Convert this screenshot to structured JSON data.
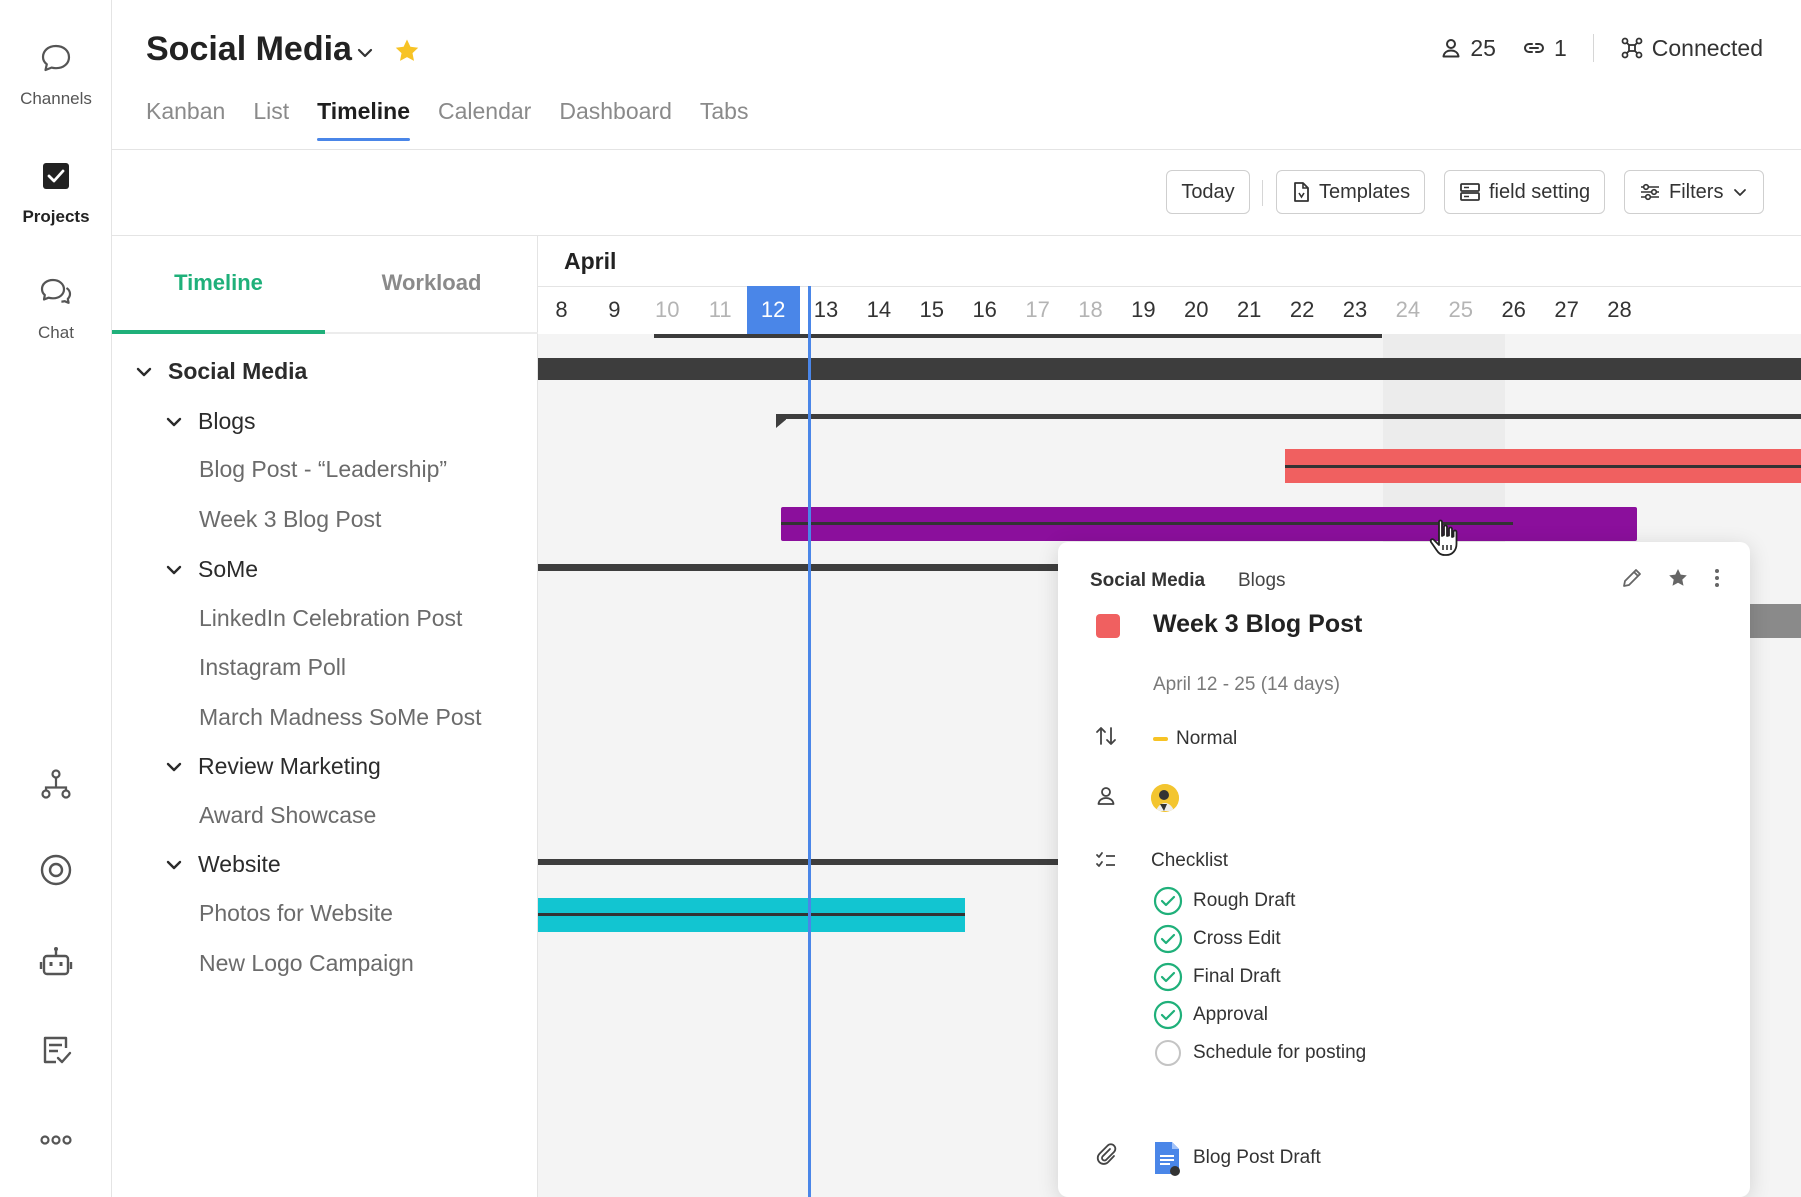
{
  "rail": {
    "top_items": [
      {
        "label": "Channels",
        "icon": "chat-bubble-icon"
      },
      {
        "label": "Projects",
        "icon": "checkbox-icon"
      },
      {
        "label": "Chat",
        "icon": "chat-double-icon"
      }
    ],
    "bottom_icons": [
      "org-chart-icon",
      "target-icon",
      "robot-icon",
      "checklist-note-icon",
      "more-dots-icon"
    ]
  },
  "header": {
    "title": "Social Media",
    "tabs": [
      "Kanban",
      "List",
      "Timeline",
      "Calendar",
      "Dashboard",
      "Tabs"
    ],
    "active_tab": "Timeline",
    "members_count": "25",
    "links_count": "1",
    "connection_status": "Connected"
  },
  "toolbar": {
    "today": "Today",
    "templates": "Templates",
    "field_setting": "field setting",
    "filters": "Filters"
  },
  "left_panel": {
    "tabs": [
      "Timeline",
      "Workload"
    ],
    "tree": [
      {
        "label": "Social Media",
        "level": "top"
      },
      {
        "label": "Blogs",
        "level": "group"
      },
      {
        "label": "Blog Post - “Leadership”",
        "level": "leaf"
      },
      {
        "label": "Week 3 Blog Post",
        "level": "leaf"
      },
      {
        "label": "SoMe",
        "level": "group"
      },
      {
        "label": "LinkedIn Celebration Post",
        "level": "leaf"
      },
      {
        "label": "Instagram Poll",
        "level": "leaf"
      },
      {
        "label": "March Madness SoMe Post",
        "level": "leaf"
      },
      {
        "label": "Review Marketing",
        "level": "group"
      },
      {
        "label": "Award Showcase",
        "level": "leaf"
      },
      {
        "label": "Website",
        "level": "group"
      },
      {
        "label": "Photos for Website",
        "level": "leaf"
      },
      {
        "label": "New Logo Campaign",
        "level": "leaf"
      }
    ]
  },
  "timeline": {
    "month": "April",
    "days": [
      "8",
      "9",
      "10",
      "11",
      "12",
      "13",
      "14",
      "15",
      "16",
      "17",
      "18",
      "19",
      "20",
      "21",
      "22",
      "23",
      "24",
      "25",
      "26",
      "27",
      "28"
    ],
    "weekend_days": [
      "10",
      "11",
      "17",
      "18",
      "24",
      "25"
    ],
    "today": "12",
    "colors": {
      "today": "#4a86e8",
      "red_bar": "#f06060",
      "purple_bar": "#8b0f9c",
      "cyan_bar": "#12c5d1",
      "dark_bar": "#3d3d3d"
    }
  },
  "card": {
    "breadcrumb_project": "Social Media",
    "breadcrumb_group": "Blogs",
    "title": "Week 3 Blog Post",
    "color": "#f06060",
    "dates": "April 12 - 25 (14 days)",
    "priority": "Normal",
    "checklist_title": "Checklist",
    "checklist": [
      {
        "label": "Rough Draft",
        "done": true
      },
      {
        "label": "Cross Edit",
        "done": true
      },
      {
        "label": "Final Draft",
        "done": true
      },
      {
        "label": "Approval",
        "done": true
      },
      {
        "label": "Schedule for posting",
        "done": false
      }
    ],
    "attachment": "Blog Post Draft"
  }
}
